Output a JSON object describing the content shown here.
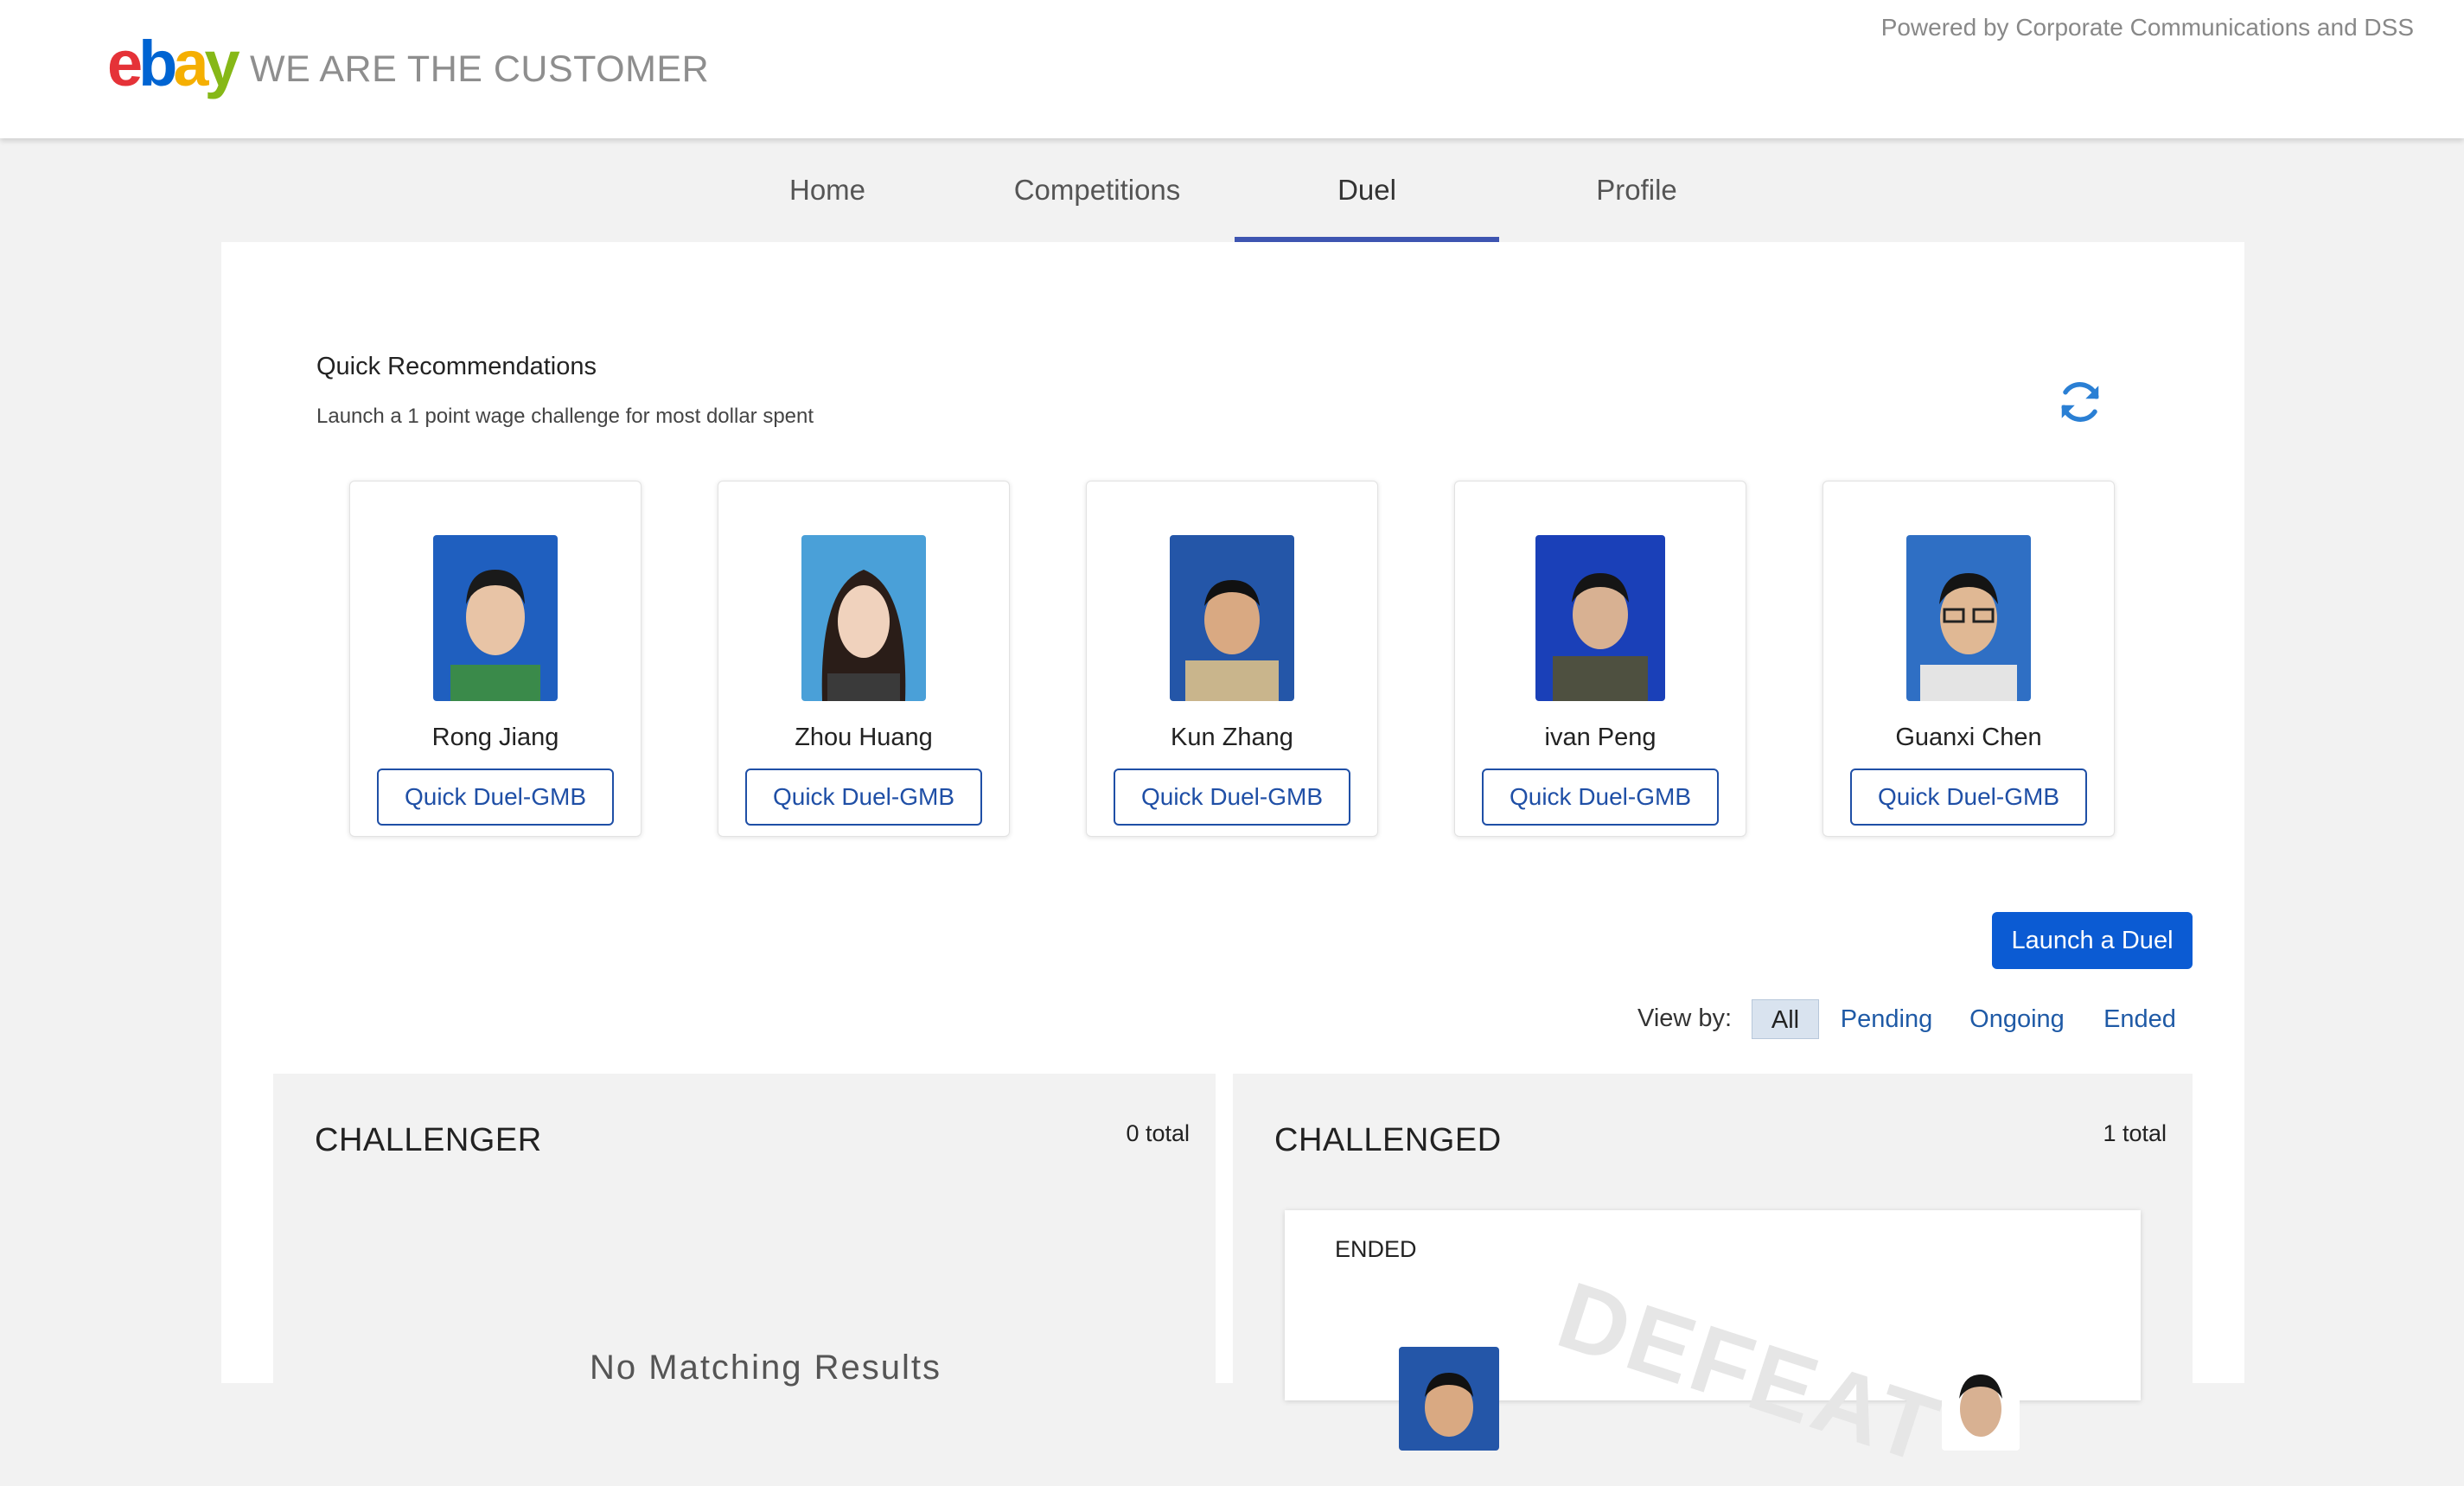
{
  "brand": {
    "logo_letters": [
      "e",
      "b",
      "a",
      "y"
    ],
    "tagline": "WE ARE THE CUSTOMER",
    "powered_by": "Powered by Corporate Communications and DSS"
  },
  "nav": {
    "tabs": [
      {
        "label": "Home",
        "active": false
      },
      {
        "label": "Competitions",
        "active": false
      },
      {
        "label": "Duel",
        "active": true
      },
      {
        "label": "Profile",
        "active": false
      }
    ]
  },
  "recommendations": {
    "title": "Quick Recommendations",
    "subtitle": "Launch a 1 point wage challenge for most dollar spent",
    "refresh_icon": "refresh-icon",
    "people": [
      {
        "name": "Rong Jiang",
        "button": "Quick Duel-GMB"
      },
      {
        "name": "Zhou Huang",
        "button": "Quick Duel-GMB"
      },
      {
        "name": "Kun Zhang",
        "button": "Quick Duel-GMB"
      },
      {
        "name": "ivan Peng",
        "button": "Quick Duel-GMB"
      },
      {
        "name": "Guanxi Chen",
        "button": "Quick Duel-GMB"
      }
    ]
  },
  "actions": {
    "launch_label": "Launch a Duel"
  },
  "filters": {
    "label": "View by:",
    "options": [
      {
        "label": "All",
        "active": true
      },
      {
        "label": "Pending",
        "active": false
      },
      {
        "label": "Ongoing",
        "active": false
      },
      {
        "label": "Ended",
        "active": false
      }
    ]
  },
  "challenger": {
    "title": "CHALLENGER",
    "total": "0 total",
    "empty_text": "No Matching Results"
  },
  "challenged": {
    "title": "CHALLENGED",
    "total": "1 total",
    "duel": {
      "status": "ENDED",
      "watermark": "DEFEAT"
    }
  },
  "colors": {
    "accent": "#3e55b1",
    "primary_button": "#0b5bd3",
    "link": "#1f5aa6"
  }
}
